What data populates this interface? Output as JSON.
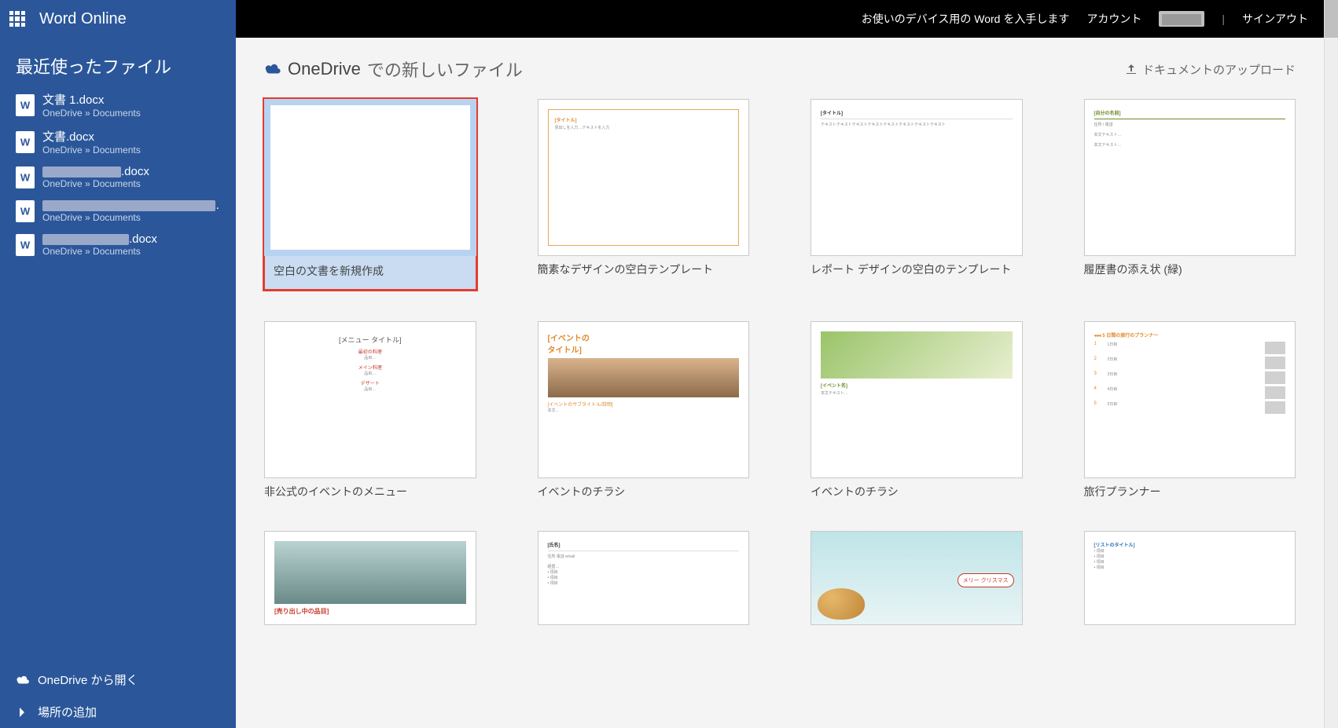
{
  "app": {
    "title": "Word Online"
  },
  "topbar": {
    "get_word": "お使いのデバイス用の Word を入手します",
    "account": "アカウント",
    "signout": "サインアウト"
  },
  "sidebar": {
    "recent_heading": "最近使ったファイル",
    "items": [
      {
        "name": "文書 1.docx",
        "path": "OneDrive » Documents",
        "redacted_w": 0
      },
      {
        "name": "文書.docx",
        "path": "OneDrive » Documents",
        "redacted_w": 0
      },
      {
        "name": ".docx",
        "path": "OneDrive » Documents",
        "redacted_w": 100
      },
      {
        "name": "",
        "path": "OneDrive » Documents",
        "redacted_w": 220
      },
      {
        "name": ".docx",
        "path": "OneDrive » Documents",
        "redacted_w": 110
      }
    ],
    "open_from": "OneDrive から開く",
    "add_location": "場所の追加"
  },
  "content": {
    "heading_prefix": "OneDrive",
    "heading_suffix": "での新しいファイル",
    "upload_label": "ドキュメントのアップロード",
    "tiles": [
      {
        "label": "空白の文書を新規作成"
      },
      {
        "label": "簡素なデザインの空白テンプレート"
      },
      {
        "label": "レポート デザインの空白のテンプレート"
      },
      {
        "label": "履歴書の添え状 (緑)"
      },
      {
        "label": "非公式のイベントのメニュー"
      },
      {
        "label": "イベントのチラシ"
      },
      {
        "label": "イベントのチラシ"
      },
      {
        "label": "旅行プランナー"
      },
      {
        "label": ""
      },
      {
        "label": ""
      },
      {
        "label": ""
      },
      {
        "label": ""
      }
    ]
  },
  "colors": {
    "brand": "#2b579a",
    "highlight": "#e73b2d"
  }
}
